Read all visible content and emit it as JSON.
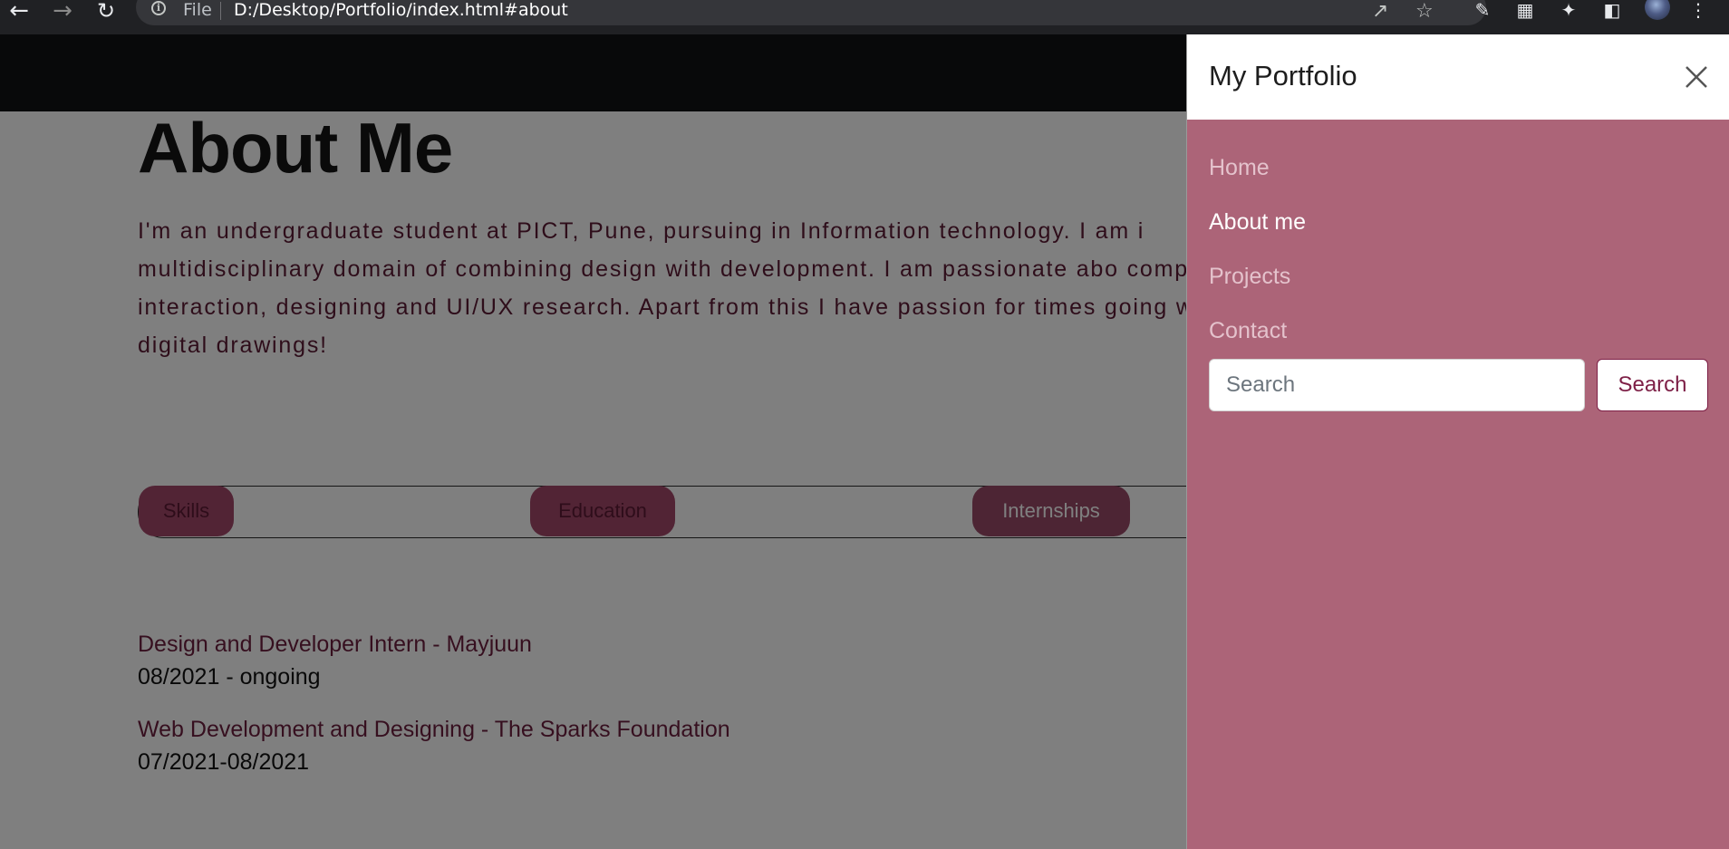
{
  "browser": {
    "scheme_label": "File",
    "url": "D:/Desktop/Portfolio/index.html#about",
    "icons": [
      "back-arrow-icon",
      "forward-arrow-icon",
      "reload-icon",
      "info-icon",
      "share-icon",
      "star-icon",
      "extension-icon",
      "puzzle-icon",
      "side-panel-icon",
      "menu-icon"
    ]
  },
  "about": {
    "title": "About Me",
    "text": "I'm an undergraduate student at PICT, Pune, pursuing in Information technology. I am i multidisciplinary domain of combining design with development. I am passionate abo computer interaction, designing and UI/UX research. Apart from this I have passion for times going with digital drawings!"
  },
  "tabs": [
    {
      "label": "Skills",
      "active": false
    },
    {
      "label": "Education",
      "active": false
    },
    {
      "label": "Internships",
      "active": true
    }
  ],
  "internships": [
    {
      "role": "Design and Developer Intern - Mayjuun",
      "date": "08/2021 - ongoing"
    },
    {
      "role": "Web Development and Designing - The Sparks Foundation",
      "date": "07/2021-08/2021"
    }
  ],
  "offcanvas": {
    "title": "My Portfolio",
    "links": [
      {
        "label": "Home",
        "active": false
      },
      {
        "label": "About me",
        "active": true
      },
      {
        "label": "Projects",
        "active": false
      },
      {
        "label": "Contact",
        "active": false
      }
    ],
    "search_placeholder": "Search",
    "search_button": "Search"
  },
  "colors": {
    "offcanvas_bg": "#ac6478",
    "accent": "#7d1f46",
    "tab_bg": "#a4486b"
  }
}
